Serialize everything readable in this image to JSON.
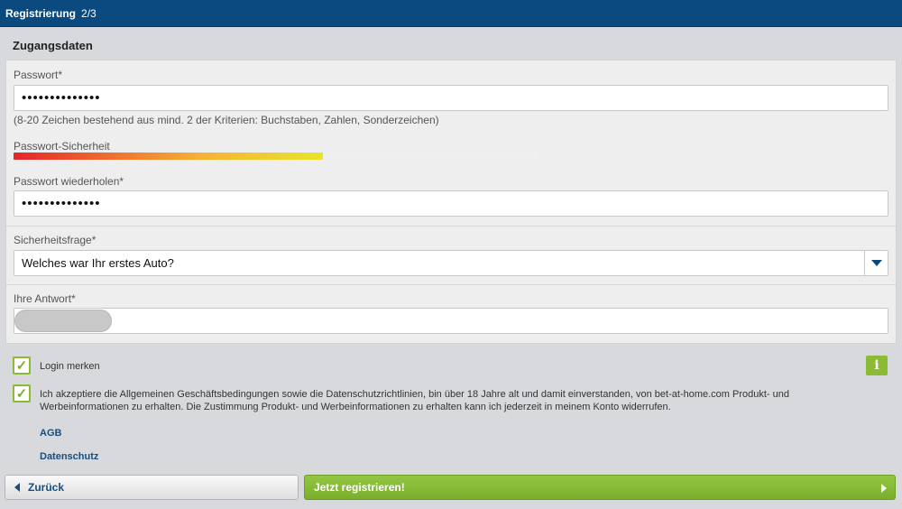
{
  "header": {
    "title": "Registrierung",
    "step": "2/3"
  },
  "section": {
    "title": "Zugangsdaten"
  },
  "password": {
    "label": "Passwort*",
    "value": "••••••••••••••",
    "hint": "(8-20 Zeichen bestehend aus mind. 2 der Kriterien: Buchstaben, Zahlen, Sonderzeichen)"
  },
  "strength": {
    "label": "Passwort-Sicherheit",
    "level_percent": 59
  },
  "password_repeat": {
    "label": "Passwort wiederholen*",
    "value": "••••••••••••••"
  },
  "security_question": {
    "label": "Sicherheitsfrage*",
    "selected": "Welches war Ihr erstes Auto?",
    "icon": "chevron-down-icon"
  },
  "answer": {
    "label": "Ihre Antwort*"
  },
  "remember_login": {
    "label": "Login merken",
    "checked": true
  },
  "terms": {
    "label": "Ich akzeptiere die Allgemeinen Geschäftsbedingungen sowie die Datenschutzrichtlinien, bin über 18 Jahre alt und damit einverstanden, von bet-at-home.com Produkt- und Werbeinformationen zu erhalten. Die Zustimmung Produkt- und Werbeinformationen zu erhalten kann ich jederzeit in meinem Konto widerrufen.",
    "checked": true
  },
  "info_button": {
    "label": "i"
  },
  "links": {
    "agb": "AGB",
    "privacy": "Datenschutz"
  },
  "buttons": {
    "back": "Zurück",
    "register": "Jetzt registrieren!"
  },
  "colors": {
    "header": "#0b4a7e",
    "accent_green": "#8bbb34",
    "link_blue": "#174e7f"
  }
}
